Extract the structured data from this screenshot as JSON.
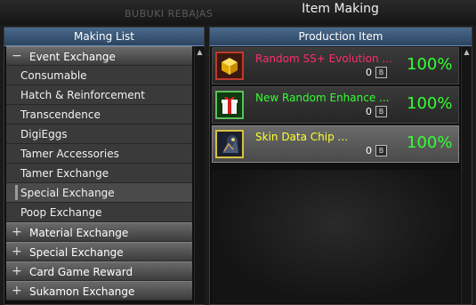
{
  "window_title": "Item Making",
  "background_caption": "BUBUKI REBAJAS",
  "left_panel": {
    "header": "Making List",
    "expanded_category": "Event Exchange",
    "sub_items": [
      {
        "label": "Consumable"
      },
      {
        "label": "Hatch & Reinforcement"
      },
      {
        "label": "Transcendence"
      },
      {
        "label": "DigiEggs"
      },
      {
        "label": "Tamer Accessories"
      },
      {
        "label": "Tamer Exchange"
      },
      {
        "label": "Special Exchange",
        "selected": true
      },
      {
        "label": "Poop Exchange"
      }
    ],
    "collapsed_categories": [
      {
        "label": "Material Exchange"
      },
      {
        "label": "Special Exchange"
      },
      {
        "label": "Card Game Reward"
      },
      {
        "label": "Sukamon Exchange"
      }
    ],
    "expanded_symbol": "−",
    "collapsed_symbol": "+"
  },
  "right_panel": {
    "header": "Production Item",
    "items": [
      {
        "name": "Random SS+ Evolution ...",
        "count": "0",
        "bind": "B",
        "rate": "100%",
        "name_color": "#ff2d6a",
        "icon": "golden-box-icon"
      },
      {
        "name": "New Random Enhance ...",
        "count": "0",
        "bind": "B",
        "rate": "100%",
        "name_color": "#33ff33",
        "icon": "gift-box-icon"
      },
      {
        "name": "Skin Data Chip ...",
        "count": "0",
        "bind": "B",
        "rate": "100%",
        "name_color": "#ffff33",
        "icon": "skin-chip-icon",
        "selected": true
      }
    ]
  },
  "colors": {
    "rate": "#33ff33",
    "header": "#2b4360"
  }
}
